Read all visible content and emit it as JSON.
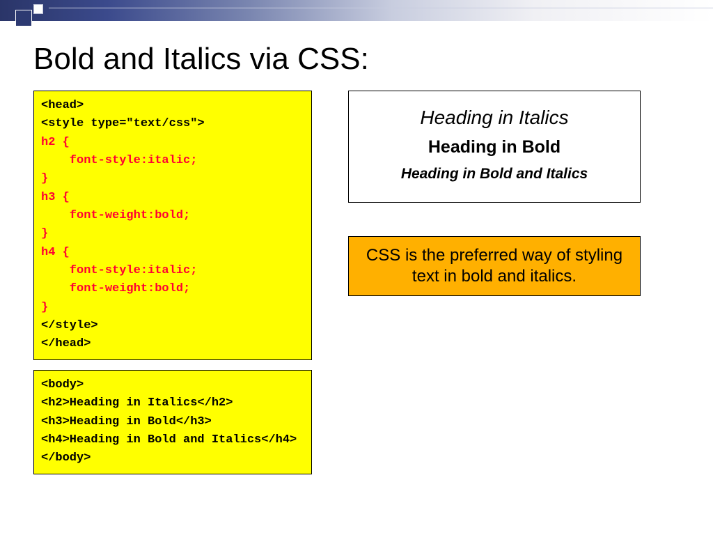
{
  "title": "Bold and Italics via CSS:",
  "code_head": {
    "l1": "<head>",
    "l2": "<style type=\"text/css\">",
    "l3": "h2 {",
    "l4": "    font-style:italic;",
    "l5": "}",
    "l6": "h3 {",
    "l7": "    font-weight:bold;",
    "l8": "}",
    "l9": "h4 {",
    "l10": "    font-style:italic;",
    "l11": "    font-weight:bold;",
    "l12": "}",
    "l13": "</style>",
    "l14": "</head>"
  },
  "code_body": {
    "l1": "<body>",
    "l2": "<h2>Heading in Italics</h2>",
    "l3": "<h3>Heading in Bold</h3>",
    "l4": "<h4>Heading in Bold and Italics</h4>",
    "l5": "</body>"
  },
  "output": {
    "h2": "Heading in Italics",
    "h3": "Heading in Bold",
    "h4": "Heading in Bold and Italics"
  },
  "note": "CSS is the preferred way of styling text in bold and italics."
}
